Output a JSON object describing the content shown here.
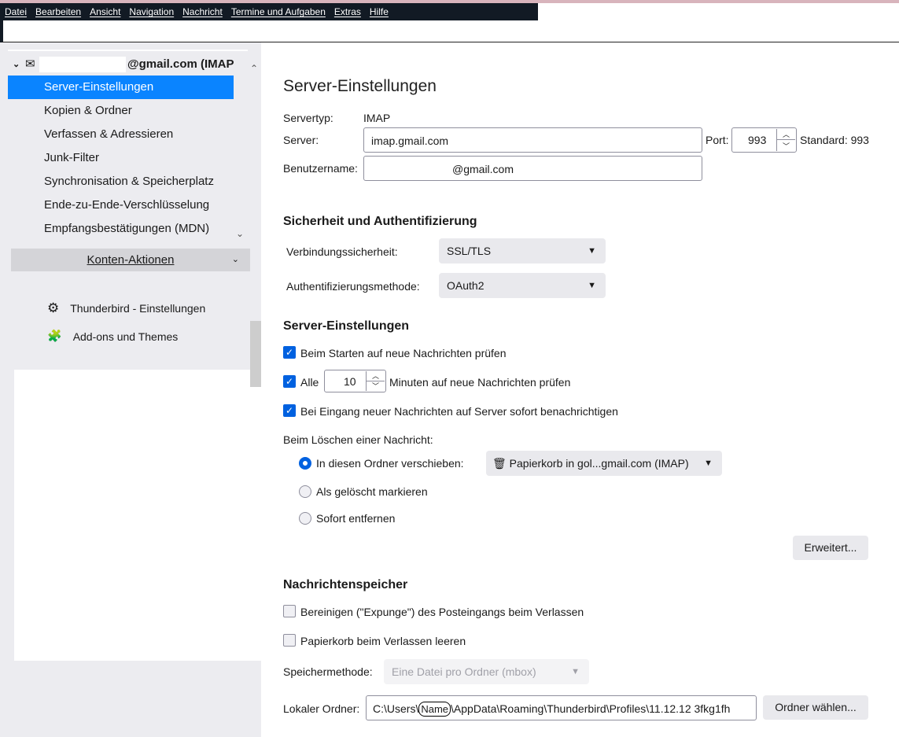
{
  "menubar": [
    "Datei",
    "Bearbeiten",
    "Ansicht",
    "Navigation",
    "Nachricht",
    "Termine und Aufgaben",
    "Extras",
    "Hilfe"
  ],
  "sidebar": {
    "account": "@gmail.com (IMAP",
    "items": [
      "Server-Einstellungen",
      "Kopien & Ordner",
      "Verfassen & Adressieren",
      "Junk-Filter",
      "Synchronisation & Speicherplatz",
      "Ende-zu-Ende-Verschlüsselung",
      "Empfangsbestätigungen (MDN)"
    ],
    "account_actions": "Konten-Aktionen",
    "settings": "Thunderbird - Einstellungen",
    "addons": "Add-ons und Themes"
  },
  "main": {
    "title": "Server-Einstellungen",
    "servertype_label": "Servertyp:",
    "servertype": "IMAP",
    "server_label": "Server:",
    "server": "imap.gmail.com",
    "port_label": "Port:",
    "port": "993",
    "standard": "Standard: 993",
    "username_label": "Benutzername:",
    "username": "@gmail.com",
    "security_heading": "Sicherheit und Authentifizierung",
    "conn_label": "Verbindungssicherheit:",
    "conn": "SSL/TLS",
    "auth_label": "Authentifizierungsmethode:",
    "auth": "OAuth2",
    "server_heading": "Server-Einstellungen",
    "check_startup": "Beim Starten auf neue Nachrichten prüfen",
    "check_every_pre": "Alle",
    "check_every_val": "10",
    "check_every_post": "Minuten auf neue Nachrichten prüfen",
    "notify": "Bei Eingang neuer Nachrichten auf Server sofort benachrichtigen",
    "delete_label": "Beim Löschen einer Nachricht:",
    "move_to": "In diesen Ordner verschieben:",
    "trash_folder": "Papierkorb in gol...gmail.com (IMAP)",
    "mark_deleted": "Als gelöscht markieren",
    "remove_now": "Sofort entfernen",
    "advanced": "Erweitert...",
    "storage_heading": "Nachrichtenspeicher",
    "expunge": "Bereinigen (\"Expunge\") des Posteingangs beim Verlassen",
    "empty_trash": "Papierkorb beim Verlassen leeren",
    "method_label": "Speichermethode:",
    "method": "Eine Datei pro Ordner (mbox)",
    "local_label": "Lokaler Ordner:",
    "local_pre": "C:\\Users\\",
    "local_name": "Name",
    "local_post": "\\AppData\\Roaming\\Thunderbird\\Profiles\\11.12.12 3fkg1fh",
    "choose_folder": "Ordner wählen..."
  }
}
